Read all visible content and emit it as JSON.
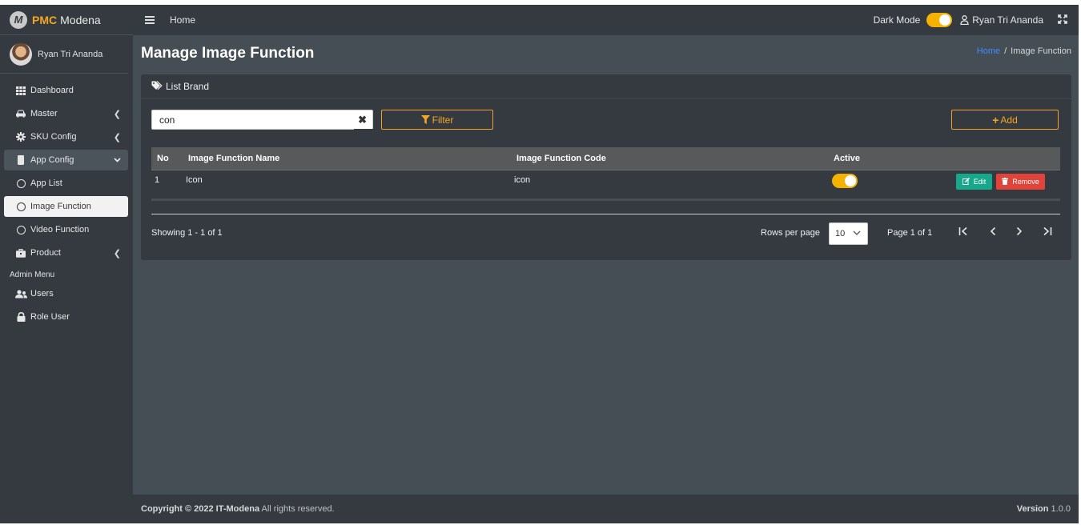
{
  "brand": {
    "logo_letter": "M",
    "pmc": "PMC",
    "name": "Modena"
  },
  "sidebar": {
    "user_name": "Ryan Tri Ananda",
    "items": [
      {
        "label": "Dashboard",
        "icon": "grid-icon"
      },
      {
        "label": "Master",
        "icon": "car-icon"
      },
      {
        "label": "SKU Config",
        "icon": "gear-icon"
      },
      {
        "label": "App Config",
        "icon": "mobile-icon"
      },
      {
        "label": "App List",
        "icon": "circle-icon"
      },
      {
        "label": "Image Function",
        "icon": "circle-icon"
      },
      {
        "label": "Video Function",
        "icon": "circle-icon"
      },
      {
        "label": "Product",
        "icon": "briefcase-icon"
      }
    ],
    "admin_header": "Admin Menu",
    "admin_items": [
      {
        "label": "Users",
        "icon": "users-icon"
      },
      {
        "label": "Role User",
        "icon": "lock-icon"
      }
    ]
  },
  "navbar": {
    "home": "Home",
    "dark_mode": "Dark Mode",
    "user_name": "Ryan Tri Ananda"
  },
  "page": {
    "title": "Manage Image Function",
    "breadcrumb": {
      "home": "Home",
      "separator": "/",
      "current": "Image Function"
    }
  },
  "card": {
    "title": "List Brand",
    "search_value": "con",
    "filter_label": "Filter",
    "add_label": "Add"
  },
  "table": {
    "headers": {
      "no": "No",
      "name": "Image Function Name",
      "code": "Image Function Code",
      "active": "Active"
    },
    "rows": [
      {
        "no": "1",
        "name": "Icon",
        "code": "icon",
        "active": true,
        "edit": "Edit",
        "remove": "Remove"
      }
    ]
  },
  "pagination": {
    "showing": "Showing 1 - 1 of 1",
    "rows_label": "Rows per page",
    "rows_value": "10",
    "page_of": "Page 1 of 1"
  },
  "footer": {
    "copyright_bold": "Copyright © 2022 IT-Modena",
    "copyright_rest": " All rights reserved.",
    "version_label": "Version",
    "version_value": " 1.0.0"
  },
  "colors": {
    "accent": "#f5a623",
    "toggle": "#f5b200",
    "edit": "#17a88b",
    "remove": "#e0433a",
    "link": "#3f8cff"
  }
}
